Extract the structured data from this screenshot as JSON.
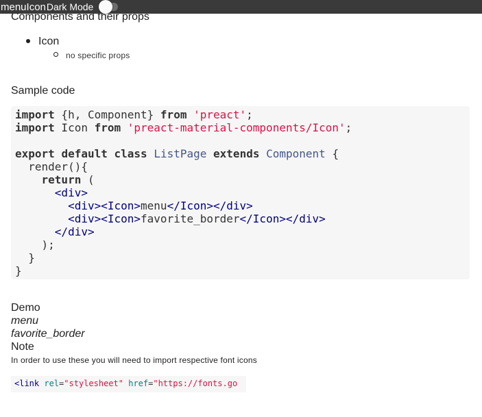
{
  "topbar": {
    "menu_text": "menuIcon",
    "dark_mode_label": "Dark Mode",
    "dark_mode_on": false
  },
  "section_components": {
    "heading": "Components and their props",
    "items": [
      {
        "label": "Icon",
        "sub": [
          "no specific props"
        ]
      }
    ]
  },
  "section_sample": {
    "heading": "Sample code",
    "code": [
      [
        {
          "t": "import",
          "c": "kw"
        },
        {
          "t": " {h, Component} ",
          "c": "plain"
        },
        {
          "t": "from",
          "c": "kw"
        },
        {
          "t": " ",
          "c": "plain"
        },
        {
          "t": "'preact'",
          "c": "str"
        },
        {
          "t": ";",
          "c": "plain"
        }
      ],
      [
        {
          "t": "import",
          "c": "kw"
        },
        {
          "t": " Icon ",
          "c": "plain"
        },
        {
          "t": "from",
          "c": "kw"
        },
        {
          "t": " ",
          "c": "plain"
        },
        {
          "t": "'preact-material-components/Icon'",
          "c": "str"
        },
        {
          "t": ";",
          "c": "plain"
        }
      ],
      [],
      [
        {
          "t": "export",
          "c": "kw"
        },
        {
          "t": " ",
          "c": "plain"
        },
        {
          "t": "default",
          "c": "kw"
        },
        {
          "t": " ",
          "c": "plain"
        },
        {
          "t": "class",
          "c": "kw"
        },
        {
          "t": " ",
          "c": "plain"
        },
        {
          "t": "ListPage",
          "c": "cls"
        },
        {
          "t": " ",
          "c": "plain"
        },
        {
          "t": "extends",
          "c": "kw"
        },
        {
          "t": " ",
          "c": "plain"
        },
        {
          "t": "Component",
          "c": "cls"
        },
        {
          "t": " {",
          "c": "plain"
        }
      ],
      [
        {
          "t": "  render(){",
          "c": "plain"
        }
      ],
      [
        {
          "t": "    ",
          "c": "plain"
        },
        {
          "t": "return",
          "c": "kw"
        },
        {
          "t": " (",
          "c": "plain"
        }
      ],
      [
        {
          "t": "      ",
          "c": "plain"
        },
        {
          "t": "<div>",
          "c": "tag"
        }
      ],
      [
        {
          "t": "        ",
          "c": "plain"
        },
        {
          "t": "<div><Icon>",
          "c": "tag"
        },
        {
          "t": "menu",
          "c": "plain"
        },
        {
          "t": "</Icon></div>",
          "c": "tag"
        }
      ],
      [
        {
          "t": "        ",
          "c": "plain"
        },
        {
          "t": "<div><Icon>",
          "c": "tag"
        },
        {
          "t": "favorite_border",
          "c": "plain"
        },
        {
          "t": "</Icon></div>",
          "c": "tag"
        }
      ],
      [
        {
          "t": "      ",
          "c": "plain"
        },
        {
          "t": "</div>",
          "c": "tag"
        }
      ],
      [
        {
          "t": "    );",
          "c": "plain"
        }
      ],
      [
        {
          "t": "  }",
          "c": "plain"
        }
      ],
      [
        {
          "t": "}",
          "c": "plain"
        }
      ]
    ]
  },
  "section_demo": {
    "heading": "Demo",
    "icons": [
      "menu",
      "favorite_border"
    ]
  },
  "section_note": {
    "heading": "Note",
    "text": "In order to use these you will need to import respective font icons",
    "snippet": [
      {
        "t": "<link",
        "c": "sn-tag"
      },
      {
        "t": " ",
        "c": "sn-eq"
      },
      {
        "t": "rel",
        "c": "sn-attr"
      },
      {
        "t": "=",
        "c": "sn-eq"
      },
      {
        "t": "\"stylesheet\"",
        "c": "sn-val"
      },
      {
        "t": " ",
        "c": "sn-eq"
      },
      {
        "t": "href",
        "c": "sn-attr"
      },
      {
        "t": "=",
        "c": "sn-eq"
      },
      {
        "t": "\"https://fonts.go",
        "c": "sn-val"
      }
    ]
  }
}
